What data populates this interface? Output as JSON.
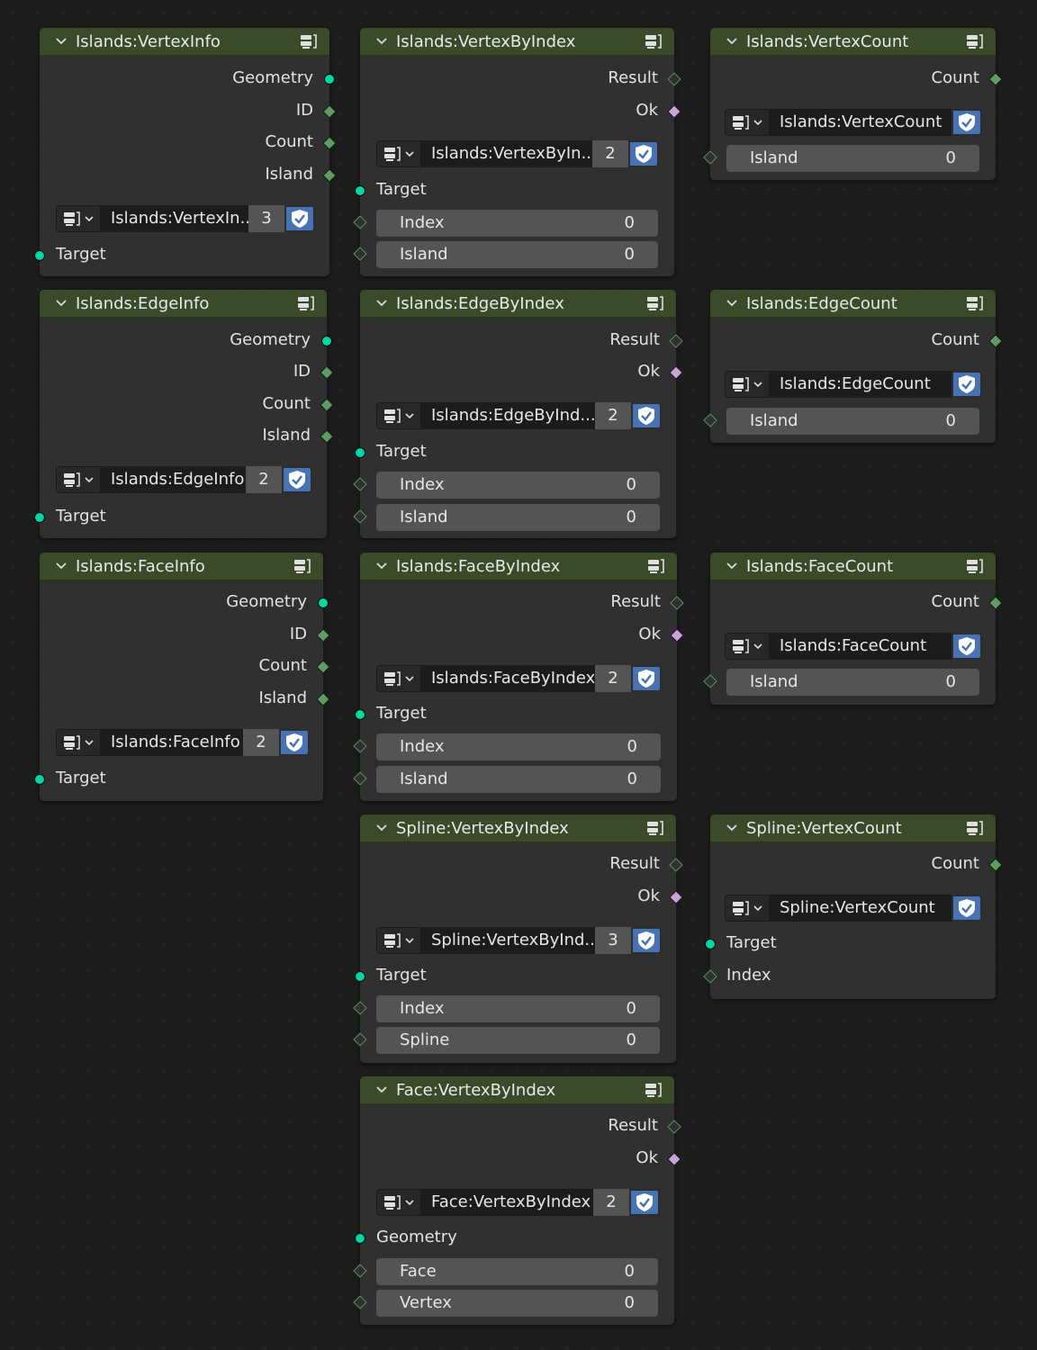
{
  "labels": {
    "geometry": "Geometry",
    "id": "ID",
    "count": "Count",
    "island": "Island",
    "target": "Target",
    "result": "Result",
    "ok": "Ok",
    "index": "Index",
    "spline": "Spline",
    "face": "Face",
    "vertex": "Vertex"
  },
  "colors": {
    "header": "#3b4b2a",
    "body": "#303030",
    "geometry_socket": "#00d6a3",
    "int_socket": "#5e9c64",
    "bool_socket": "#c9a3d9",
    "shield": "#4772b3"
  },
  "nodes": {
    "vertex_info": {
      "title": "Islands:VertexInfo",
      "group_name": "Islands:VertexIn...",
      "users": "3"
    },
    "vertex_by_index": {
      "title": "Islands:VertexByIndex",
      "group_name": "Islands:VertexByIn...",
      "users": "2",
      "index_value": "0",
      "island_value": "0"
    },
    "vertex_count": {
      "title": "Islands:VertexCount",
      "group_name": "Islands:VertexCount",
      "island_value": "0"
    },
    "edge_info": {
      "title": "Islands:EdgeInfo",
      "group_name": "Islands:EdgeInfo",
      "users": "2"
    },
    "edge_by_index": {
      "title": "Islands:EdgeByIndex",
      "group_name": "Islands:EdgeByInd...",
      "users": "2",
      "index_value": "0",
      "island_value": "0"
    },
    "edge_count": {
      "title": "Islands:EdgeCount",
      "group_name": "Islands:EdgeCount",
      "island_value": "0"
    },
    "face_info": {
      "title": "Islands:FaceInfo",
      "group_name": "Islands:FaceInfo",
      "users": "2"
    },
    "face_by_index": {
      "title": "Islands:FaceByIndex",
      "group_name": "Islands:FaceByIndex",
      "users": "2",
      "index_value": "0",
      "island_value": "0"
    },
    "face_count": {
      "title": "Islands:FaceCount",
      "group_name": "Islands:FaceCount",
      "island_value": "0"
    },
    "spline_vertex_by_index": {
      "title": "Spline:VertexByIndex",
      "group_name": "Spline:VertexByInd...",
      "users": "3",
      "index_value": "0",
      "spline_value": "0"
    },
    "spline_vertex_count": {
      "title": "Spline:VertexCount",
      "group_name": "Spline:VertexCount"
    },
    "face_vertex_by_index": {
      "title": "Face:VertexByIndex",
      "group_name": "Face:VertexByIndex",
      "users": "2",
      "face_value": "0",
      "vertex_value": "0"
    }
  }
}
